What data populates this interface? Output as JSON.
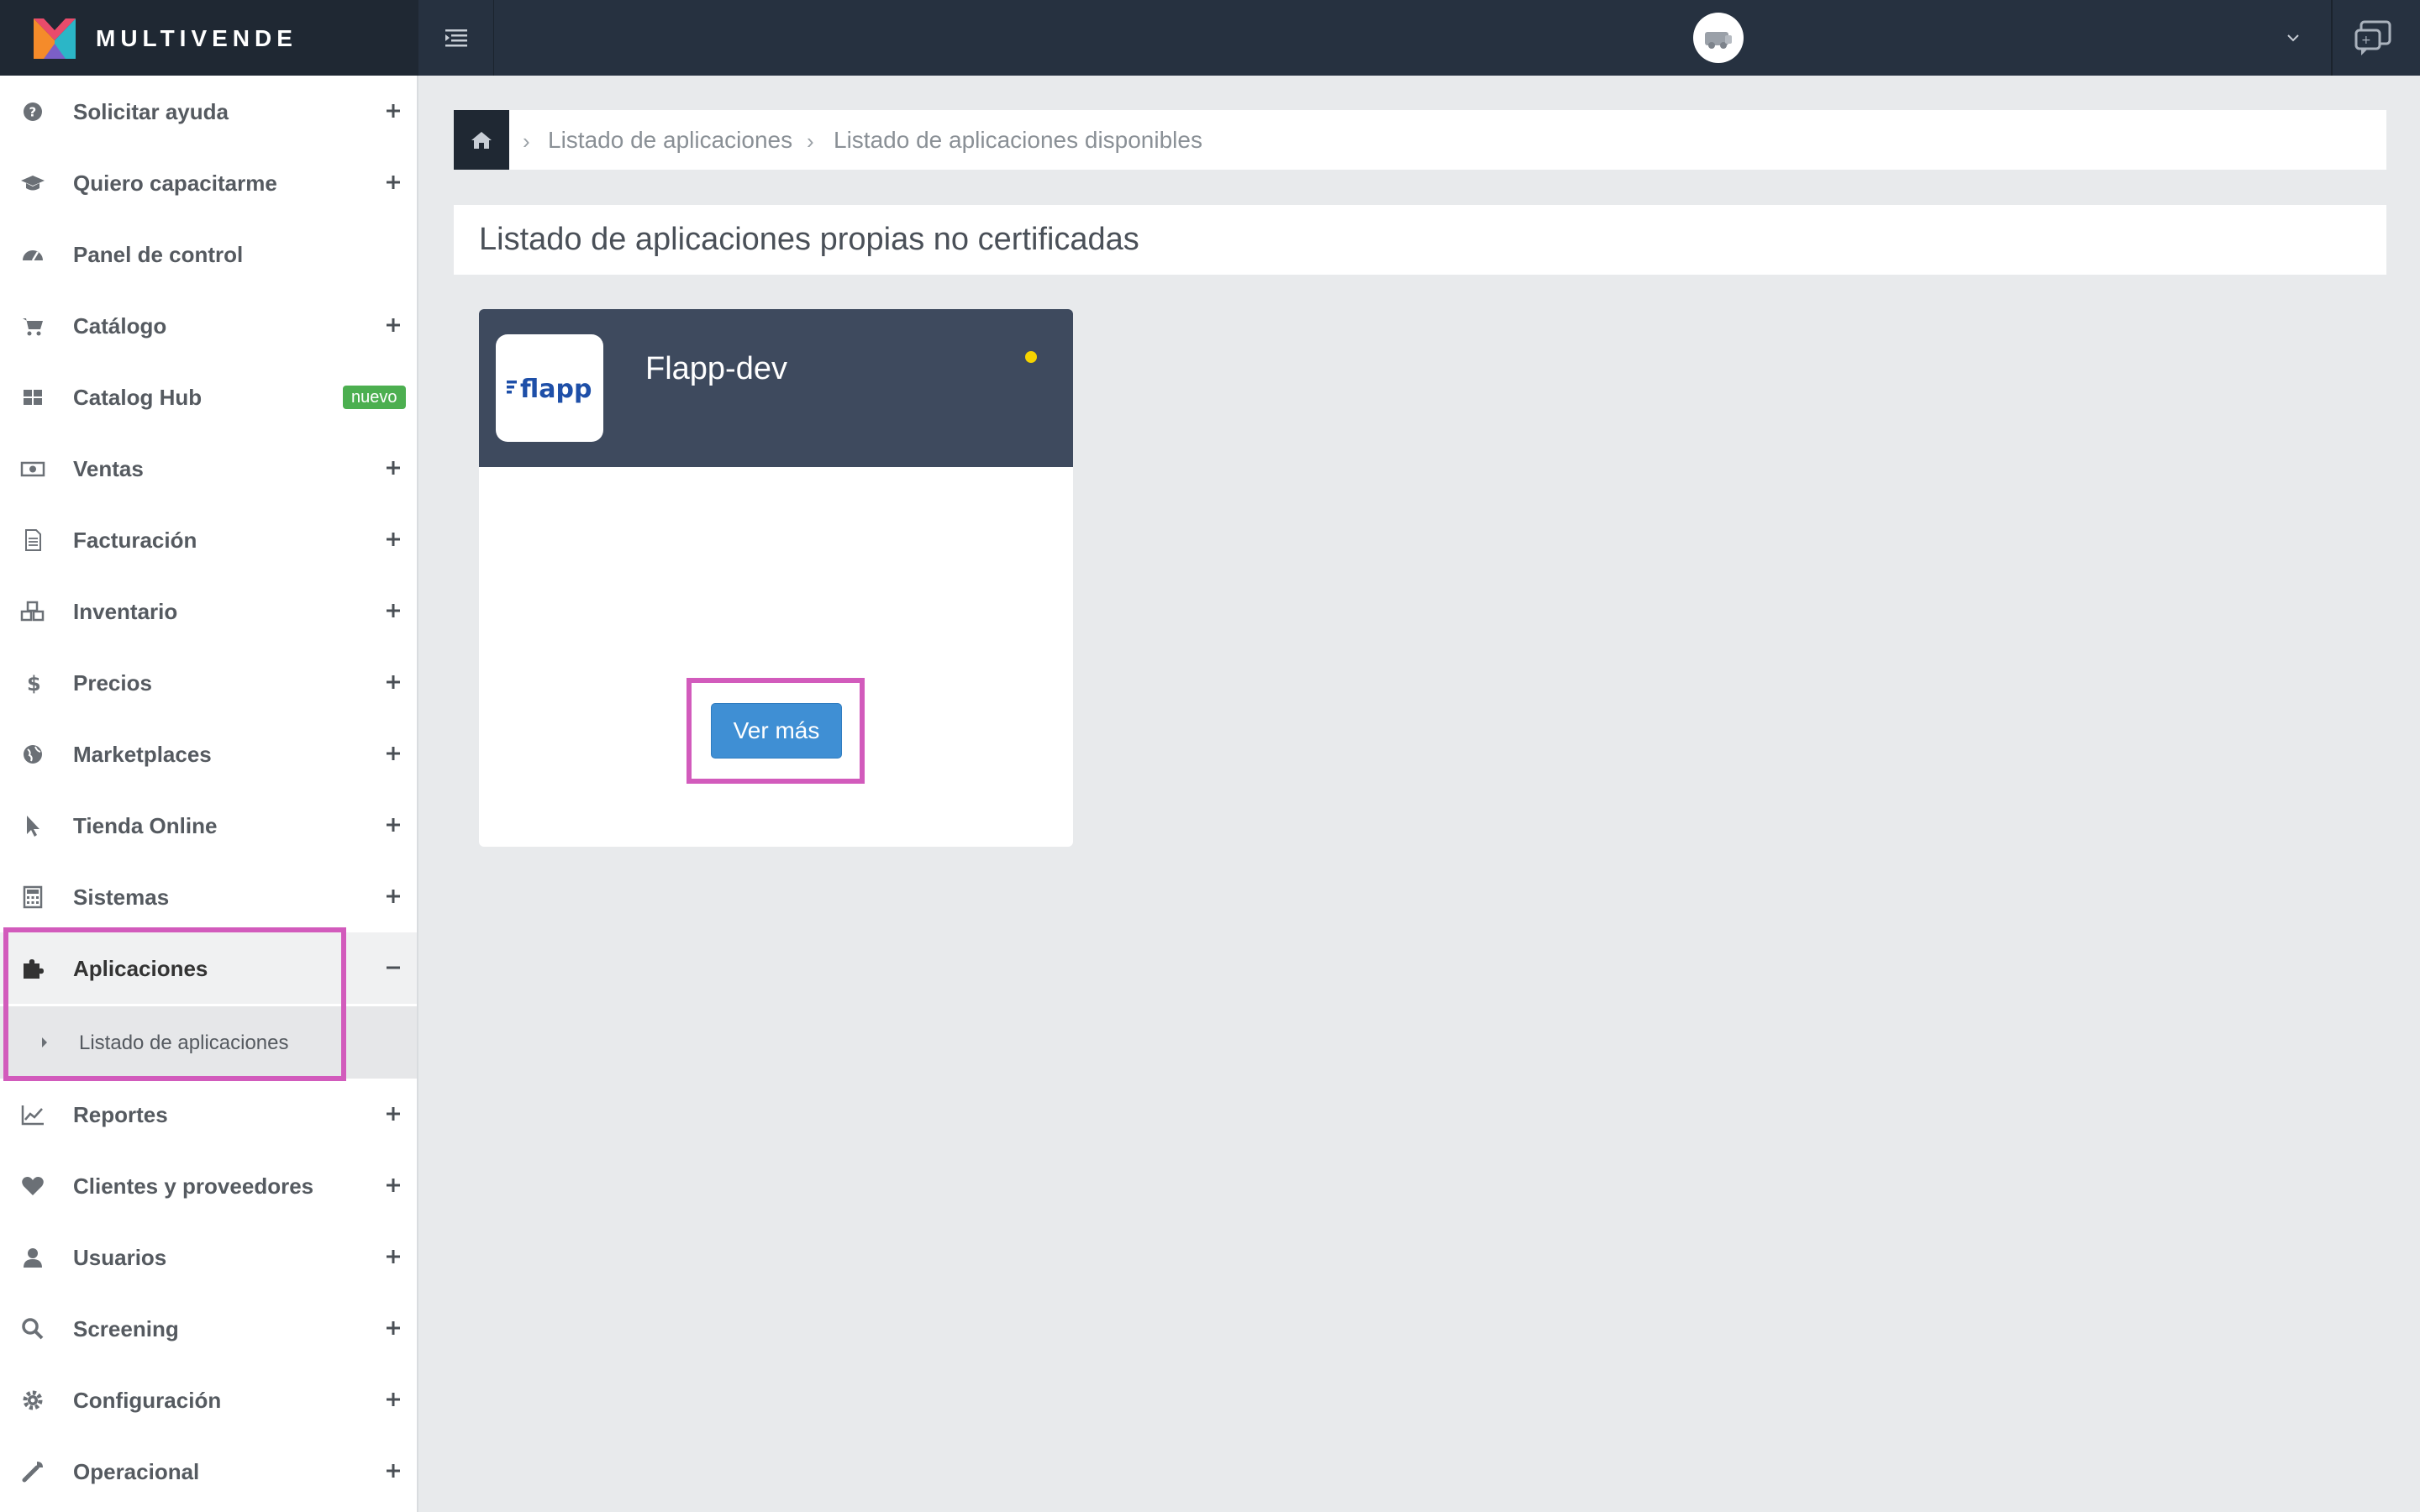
{
  "brand": {
    "name": "MULTIVENDE"
  },
  "sidebar": {
    "items": [
      {
        "label": "Solicitar ayuda",
        "icon": "question-circle-icon",
        "expander": "+"
      },
      {
        "label": "Quiero capacitarme",
        "icon": "graduation-cap-icon",
        "expander": "+"
      },
      {
        "label": "Panel de control",
        "icon": "dashboard-icon",
        "expander": ""
      },
      {
        "label": "Catálogo",
        "icon": "cart-icon",
        "expander": "+"
      },
      {
        "label": "Catalog Hub",
        "icon": "grid-icon",
        "badge": "nuevo"
      },
      {
        "label": "Ventas",
        "icon": "money-icon",
        "expander": "+"
      },
      {
        "label": "Facturación",
        "icon": "document-icon",
        "expander": "+"
      },
      {
        "label": "Inventario",
        "icon": "cubes-icon",
        "expander": "+"
      },
      {
        "label": "Precios",
        "icon": "dollar-icon",
        "expander": "+"
      },
      {
        "label": "Marketplaces",
        "icon": "globe-icon",
        "expander": "+"
      },
      {
        "label": "Tienda Online",
        "icon": "pointer-icon",
        "expander": "+"
      },
      {
        "label": "Sistemas",
        "icon": "calculator-icon",
        "expander": "+"
      },
      {
        "label": "Aplicaciones",
        "icon": "puzzle-icon",
        "expander": "−",
        "active": true
      },
      {
        "label": "Reportes",
        "icon": "line-chart-icon",
        "expander": "+"
      },
      {
        "label": "Clientes y proveedores",
        "icon": "heart-icon",
        "expander": "+"
      },
      {
        "label": "Usuarios",
        "icon": "user-icon",
        "expander": "+"
      },
      {
        "label": "Screening",
        "icon": "search-icon",
        "expander": "+"
      },
      {
        "label": "Configuración",
        "icon": "gear-icon",
        "expander": "+"
      },
      {
        "label": "Operacional",
        "icon": "wrench-icon",
        "expander": "+"
      }
    ],
    "subitem": {
      "label": "Listado de aplicaciones"
    }
  },
  "breadcrumb": {
    "items": [
      "Listado de aplicaciones",
      "Listado de aplicaciones disponibles"
    ],
    "separator": "›"
  },
  "section": {
    "title": "Listado de aplicaciones propias no certificadas"
  },
  "app_card": {
    "name": "Flapp-dev",
    "logo_text": "flapp",
    "status_color": "#f5d300",
    "button_label": "Ver más"
  },
  "colors": {
    "topbar": "#263140",
    "card_header": "#3e4a5e",
    "button": "#3f8fd4",
    "highlight": "#d25bbc",
    "badge": "#4caf50"
  }
}
